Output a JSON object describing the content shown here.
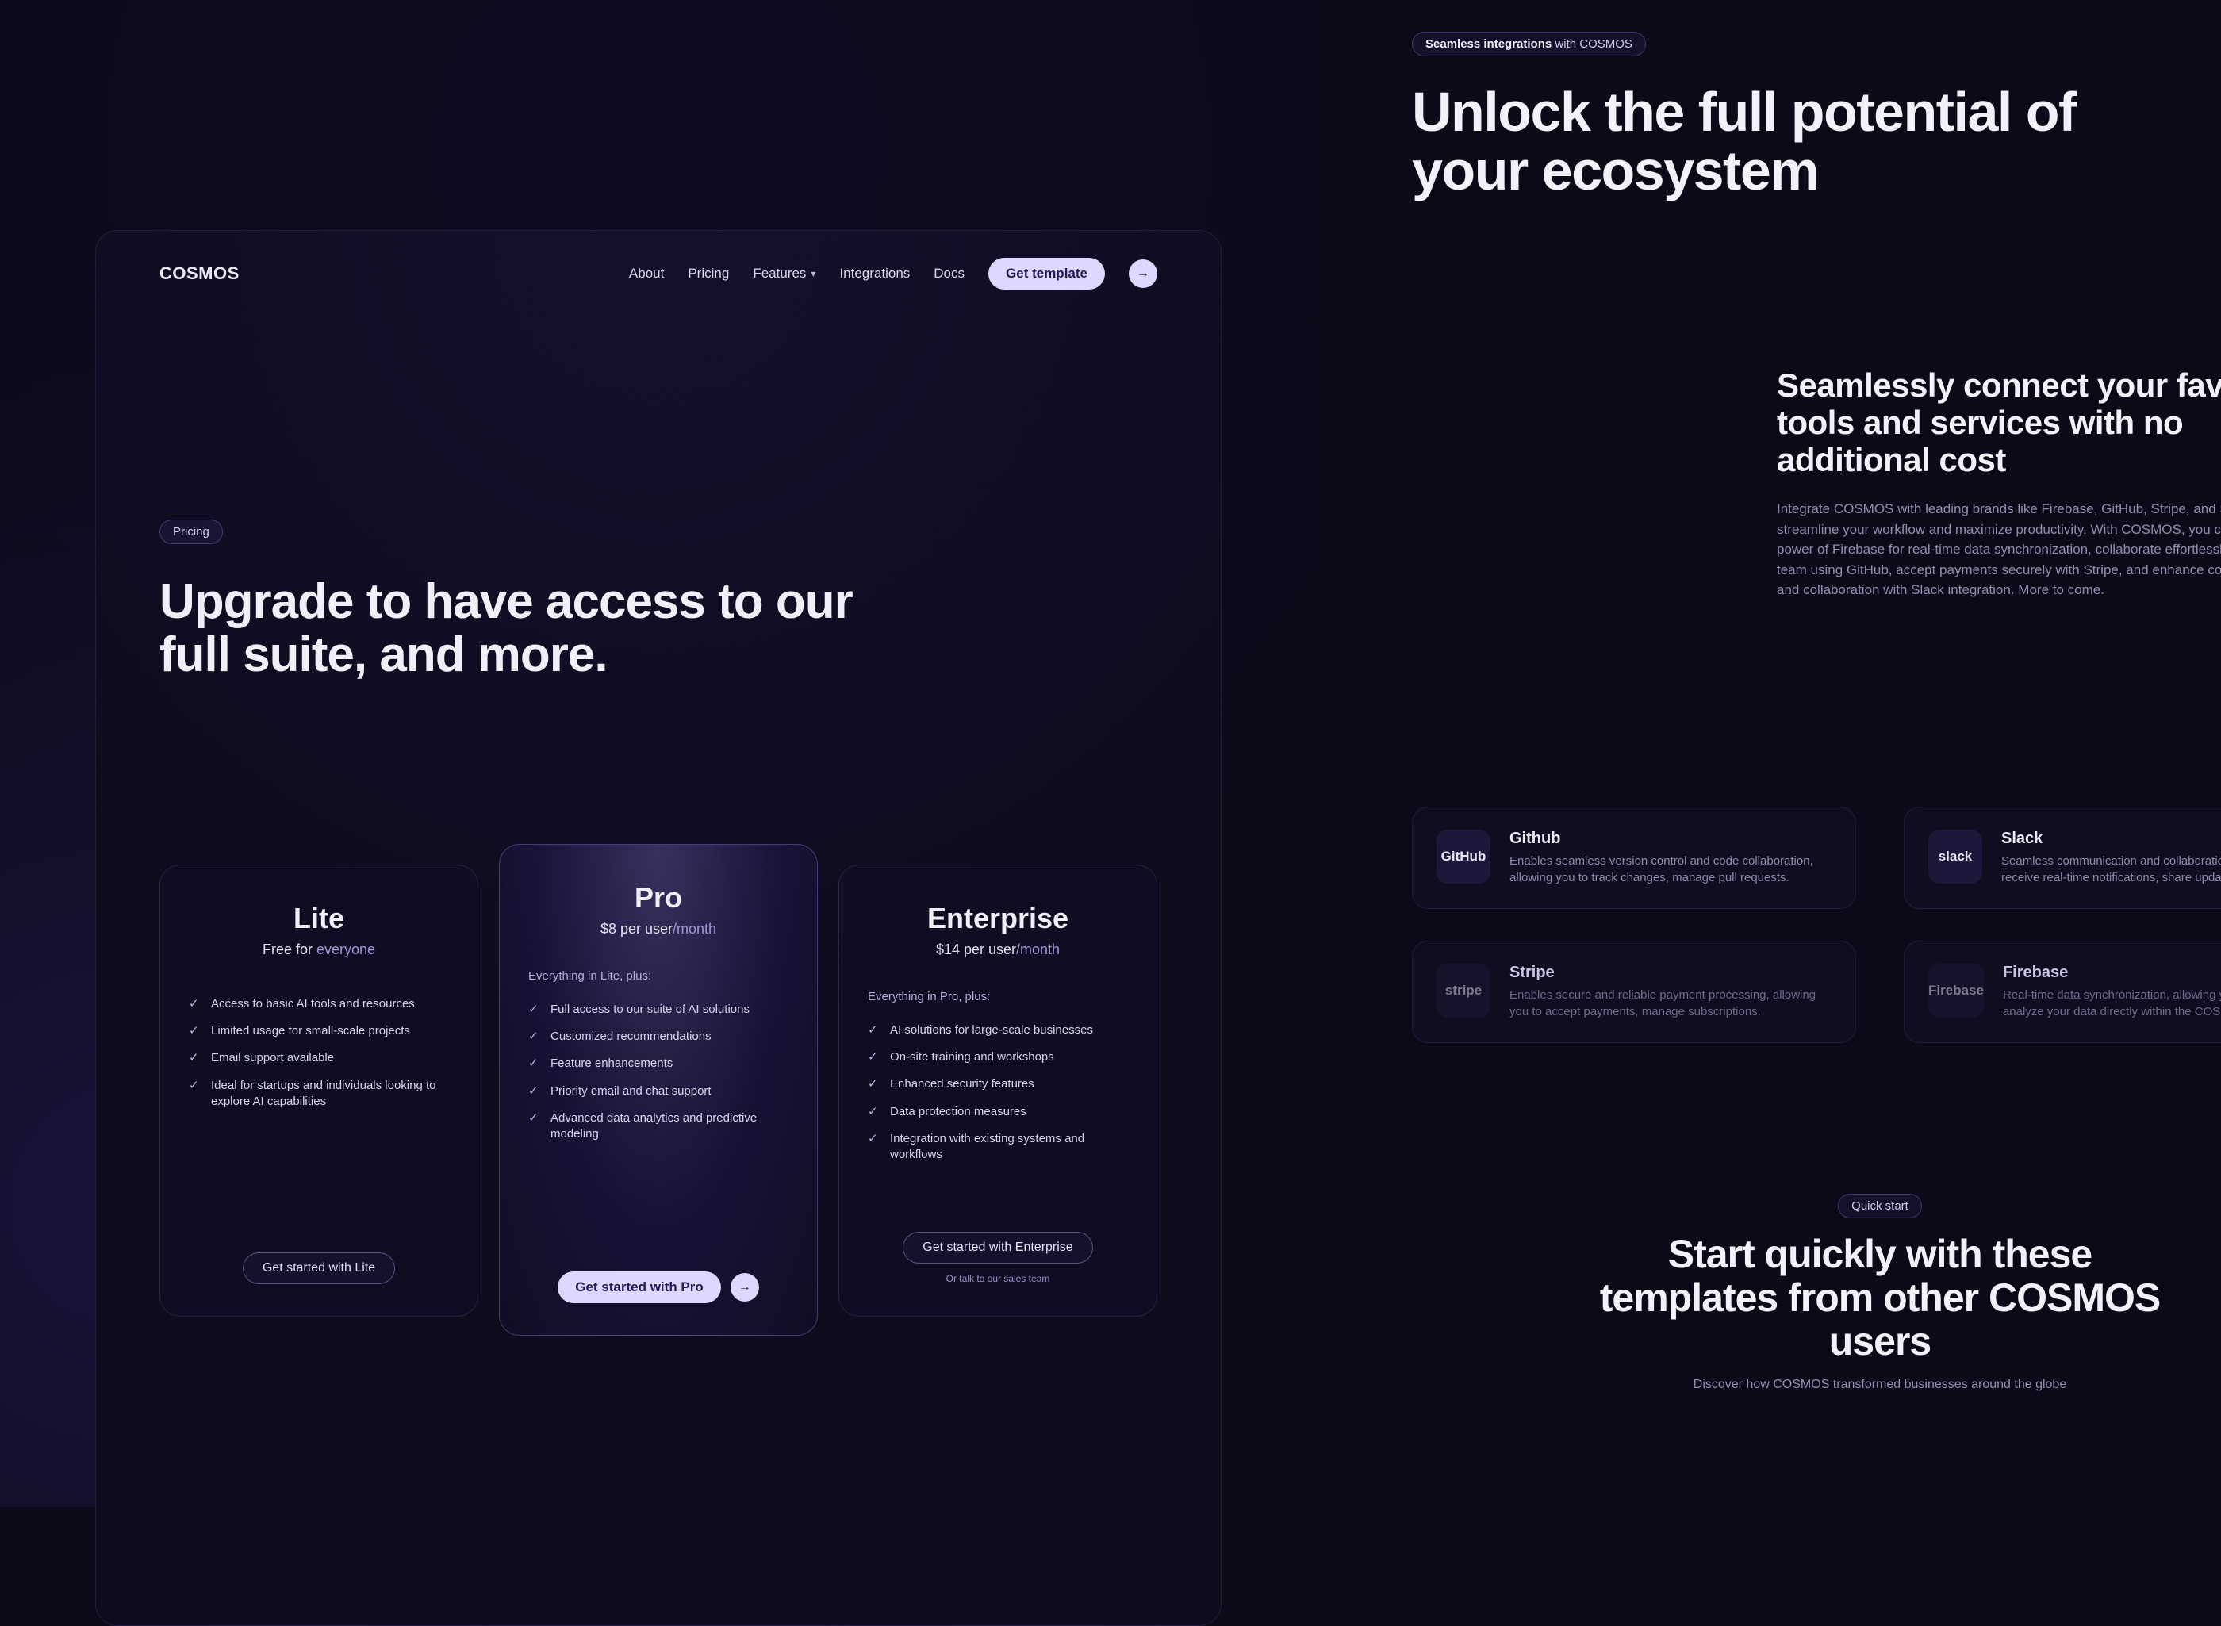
{
  "left": {
    "logo": "COSMOS",
    "nav": {
      "about": "About",
      "pricing": "Pricing",
      "features": "Features",
      "integrations": "Integrations",
      "docs": "Docs",
      "get_template": "Get template"
    },
    "tag": "Pricing",
    "hero": "Upgrade to have access to our full suite, and more.",
    "plans": {
      "lite": {
        "name": "Lite",
        "price_prefix": "Free for ",
        "price_suffix": "everyone",
        "features": [
          "Access to basic AI tools and resources",
          "Limited usage for small-scale projects",
          "Email support available",
          "Ideal for startups and individuals looking to explore AI capabilities"
        ],
        "cta": "Get started with Lite"
      },
      "pro": {
        "name": "Pro",
        "price_prefix": "$8 per user",
        "price_suffix": "/month",
        "lead": "Everything in Lite, plus:",
        "features": [
          "Full access to our suite of AI solutions",
          "Customized recommendations",
          "Feature enhancements",
          "Priority email and chat support",
          "Advanced data analytics and predictive modeling"
        ],
        "cta": "Get started with Pro"
      },
      "enterprise": {
        "name": "Enterprise",
        "price_prefix": "$14 per user",
        "price_suffix": "/month",
        "lead": "Everything in Pro, plus:",
        "features": [
          "AI solutions for large-scale businesses",
          "On-site training and workshops",
          "Enhanced security features",
          "Data protection measures",
          "Integration with existing systems and workflows"
        ],
        "cta": "Get started with Enterprise",
        "cta2": "Or talk to our sales team"
      }
    }
  },
  "right": {
    "tag_prefix": "Seamless integrations",
    "tag_suffix": " with COSMOS",
    "hero": "Unlock the full potential of your ecosystem",
    "sub_title": "Seamlessly connect your favorite tools and services with no additional cost",
    "sub_body": "Integrate COSMOS with leading brands like Firebase, GitHub, Stripe, and Slack to streamline your workflow and maximize productivity. With COSMOS, you can leverage the power of Firebase for real-time data synchronization, collaborate effortlessly with your team using GitHub, accept payments securely with Stripe, and enhance communication and collaboration with Slack integration. More to come.",
    "integrations": [
      {
        "logo": "GitHub",
        "title": "Github",
        "desc": "Enables seamless version control and code collaboration, allowing you to track changes, manage pull requests."
      },
      {
        "logo": "slack",
        "title": "Slack",
        "desc": "Seamless communication and collaboration, enabling you to receive real-time notifications, share updates."
      },
      {
        "logo": "stripe",
        "title": "Stripe",
        "desc": "Enables secure and reliable payment processing, allowing you to accept payments, manage subscriptions."
      },
      {
        "logo": "Firebase",
        "title": "Firebase",
        "desc": "Real-time data synchronization, allowing you to store and analyze your data directly within the COSMOS platform."
      }
    ],
    "quickstart": {
      "tag": "Quick start",
      "title": "Start quickly with these templates from other COSMOS users",
      "sub": "Discover how COSMOS transformed businesses around the globe"
    }
  }
}
